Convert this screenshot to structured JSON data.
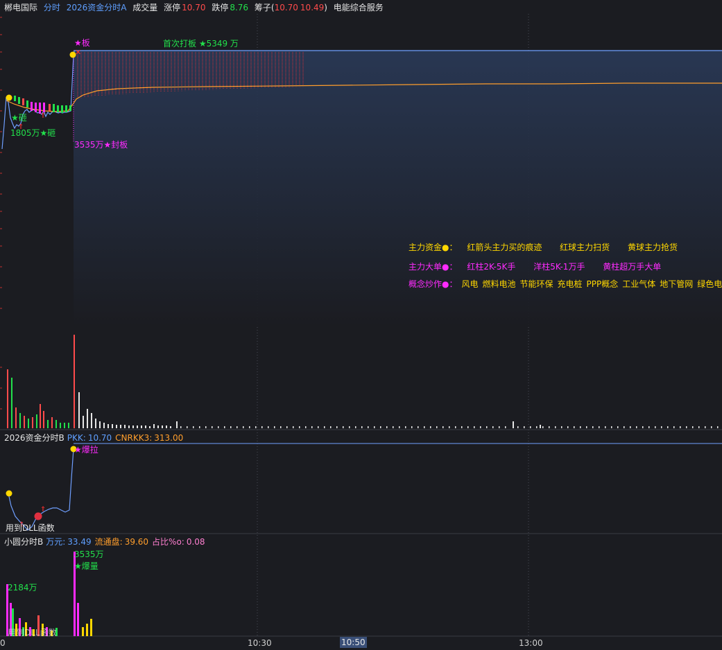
{
  "header": {
    "stock_name": "郴电国际",
    "mode": "分时",
    "indicator": "2026资金分时A",
    "volume_label": "成交量",
    "limit_up_label": "涨停",
    "limit_up_value": "10.70",
    "limit_down_label": "跌停",
    "limit_down_value": "8.76",
    "chips_label": "筹子(",
    "chips_v1": "10.70",
    "chips_v2": "10.49",
    "chips_end": ")",
    "sector": "电能综合服务"
  },
  "annotations": {
    "board_star": "★板",
    "first_board": "首次打板 ★5349 万",
    "smash1": "★砸",
    "smash2": "1805万★砸",
    "seal_board": "3535万★封板",
    "surge": "★爆拉",
    "use_dll_1": "用到DLL函数",
    "amount_2184": "2184万",
    "amount_3535": "3535万",
    "burst_volume": "★爆量",
    "use_dll_2": "用到DLL函数"
  },
  "legend": {
    "row1_title": "主力资金●：",
    "row1_items": [
      "红箭头主力买的痕迹",
      "红球主力扫货",
      "黄球主力抢货"
    ],
    "row2_title": "主力大单●：",
    "row2_items": [
      "红柱2K-5K手",
      "洋柱5K-1万手",
      "黄柱超万手大单"
    ],
    "row3_title": "概念炒作●：",
    "row3_items": [
      "风电",
      "燃料电池",
      "节能环保",
      "充电桩",
      "PPP概念",
      "工业气体",
      "地下管网",
      "绿色电力"
    ]
  },
  "panel2": {
    "name": "2026资金分时B",
    "pkk_label": "PKK:",
    "pkk_value": "10.70",
    "cnrkk_label": "CNRKK3:",
    "cnrkk_value": "313.00"
  },
  "panel3": {
    "name": "小圆分时B",
    "wan_label": "万元:",
    "wan_value": "33.49",
    "float_label": "流通盘:",
    "float_value": "39.60",
    "ratio_label": "占比%o:",
    "ratio_value": "0.08"
  },
  "time_axis": {
    "start": "0",
    "t1": "10:30",
    "current": "10:50",
    "t2": "13:00"
  },
  "colors": {
    "background": "#1b1c21",
    "price_line": "#6f9fff",
    "avg_line": "#ff9e2c",
    "up": "#ff4b4b",
    "down": "#22e04b",
    "magenta": "#ff2bff",
    "yellow": "#ffd700"
  }
}
